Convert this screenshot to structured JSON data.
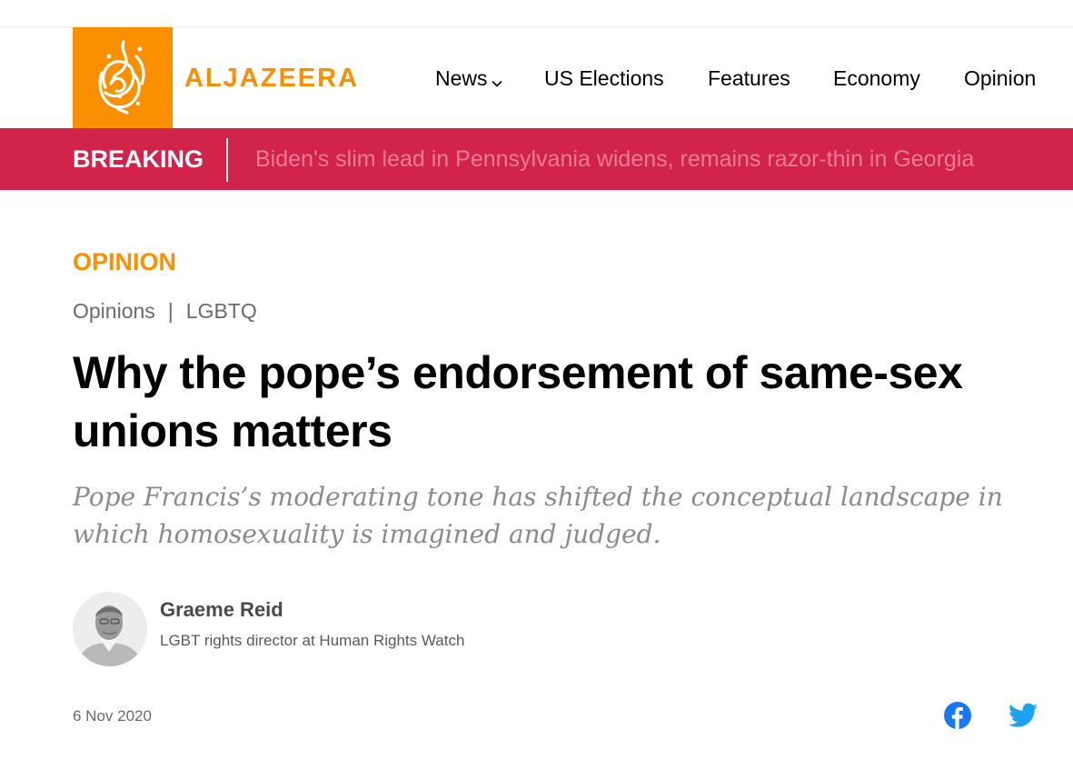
{
  "header": {
    "brand": "ALJAZEERA",
    "colors": {
      "brand_orange": "#fa9000",
      "breaking_red": "#d2234a"
    },
    "logo_icon": "aljazeera-calligraphy-logo",
    "nav": [
      {
        "label": "News",
        "has_dropdown": true,
        "icon": "chevron-down-icon"
      },
      {
        "label": "US Elections"
      },
      {
        "label": "Features"
      },
      {
        "label": "Economy"
      },
      {
        "label": "Opinion"
      }
    ]
  },
  "breaking": {
    "label": "BREAKING",
    "headline": "Biden's slim lead in Pennsylvania widens, remains razor-thin in Georgia"
  },
  "article": {
    "kicker": "OPINION",
    "tags": [
      "Opinions",
      "LGBTQ"
    ],
    "tag_separator": "|",
    "headline": "Why the pope’s endorsement of same-sex unions matters",
    "standfirst": "Pope Francis’s moderating tone has shifted the conceptual landscape in which homosexuality is imagined and judged.",
    "author": {
      "name": "Graeme Reid",
      "role": "LGBT rights director at Human Rights Watch"
    },
    "date": "6 Nov 2020",
    "share": [
      {
        "network": "Facebook",
        "icon": "facebook-icon",
        "color": "#1877f2"
      },
      {
        "network": "Twitter",
        "icon": "twitter-icon",
        "color": "#1da1f2"
      }
    ]
  }
}
